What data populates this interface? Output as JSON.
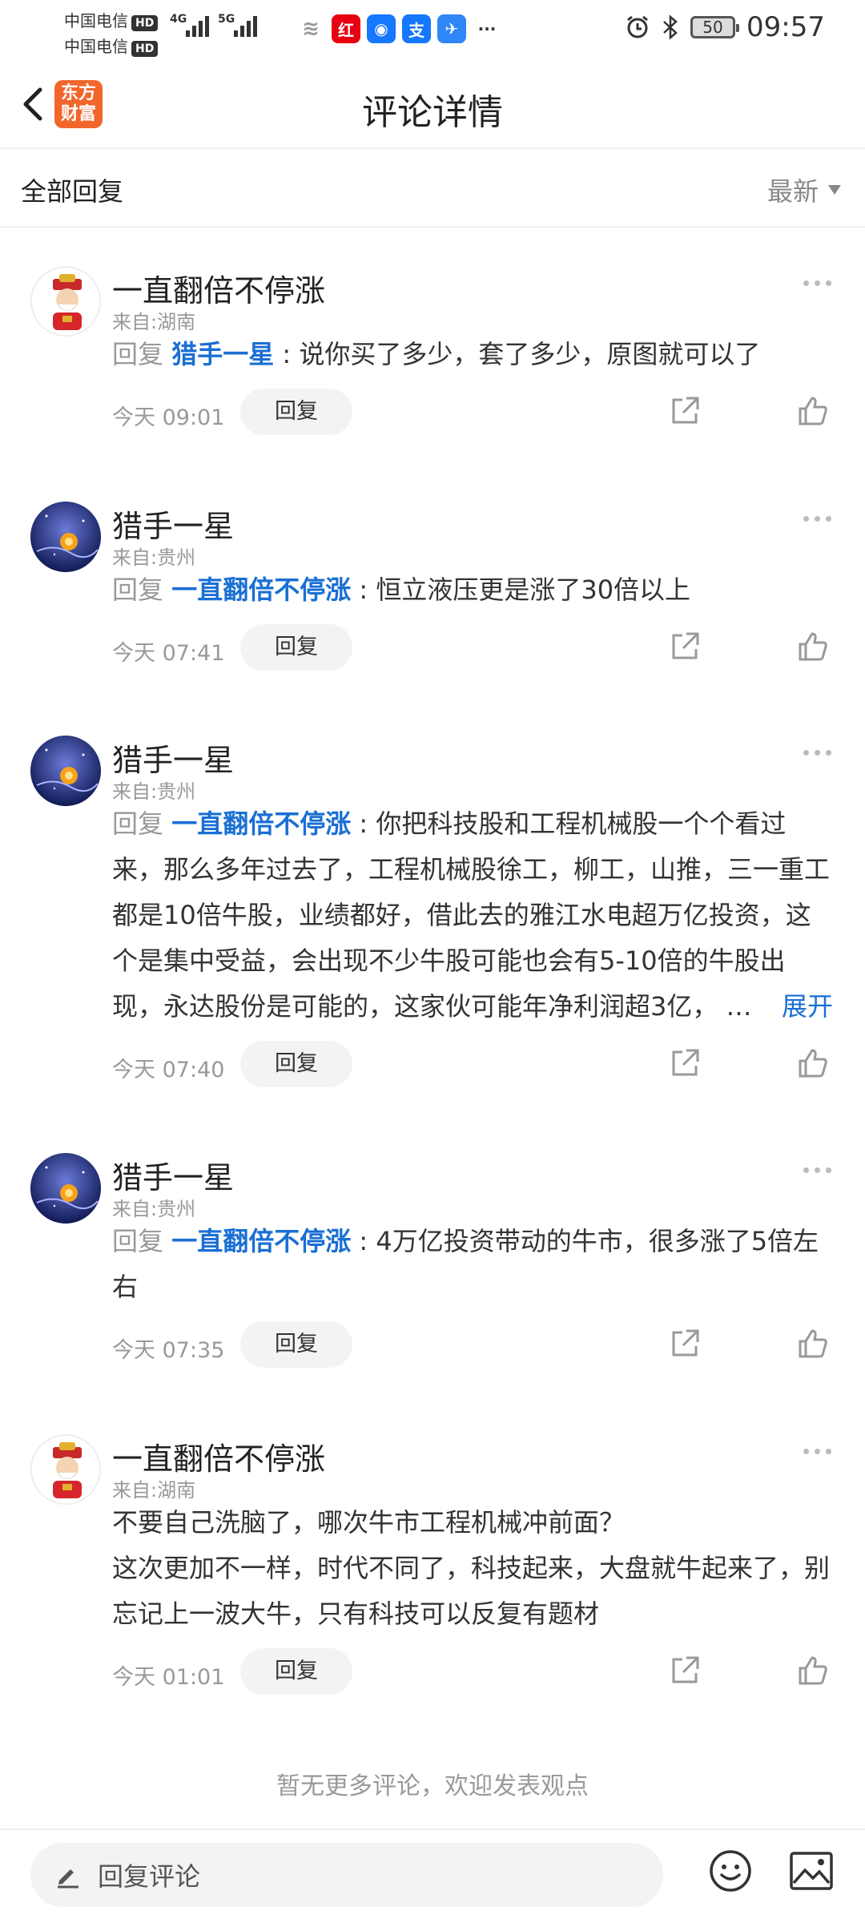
{
  "status_bar": {
    "carrier1": "中国电信",
    "carrier2": "中国电信",
    "hd_badge": "HD",
    "net1": "4G",
    "net2": "5G",
    "app_icons": [
      "weibo-icon",
      "ximalaya-icon",
      "qq-icon",
      "alipay-icon",
      "mail-icon"
    ],
    "more_dots": "···",
    "battery": "50",
    "time": "09:57"
  },
  "header": {
    "logo_line1": "东方",
    "logo_line2": "财富",
    "title": "评论详情"
  },
  "subheader": {
    "all_replies": "全部回复",
    "sort_label": "最新"
  },
  "comments": [
    {
      "user": "一直翻倍不停涨",
      "location": "来自:湖南",
      "reply_prefix": "回复",
      "mention": "猎手一星",
      "text": " : 说你买了多少，套了多少，原图就可以了",
      "time": "今天 09:01",
      "reply_label": "回复"
    },
    {
      "user": "猎手一星",
      "location": "来自:贵州",
      "reply_prefix": "回复",
      "mention": "一直翻倍不停涨",
      "text": " : 恒立液压更是涨了30倍以上",
      "time": "今天 07:41",
      "reply_label": "回复"
    },
    {
      "user": "猎手一星",
      "location": "来自:贵州",
      "reply_prefix": "回复",
      "mention": "一直翻倍不停涨",
      "text": " : 你把科技股和工程机械股一个个看过来，那么多年过去了，工程机械股徐工，柳工，山推，三一重工都是10倍牛股，业绩都好，借此去的雅江水电超万亿投资，这个是集中受益，会出现不少牛股可能也会有5-10倍的牛股出现，永达股份是可能的，这家伙可能年净利润超3亿，",
      "ellipsis": "…",
      "expand": "展开",
      "time": "今天 07:40",
      "reply_label": "回复"
    },
    {
      "user": "猎手一星",
      "location": "来自:贵州",
      "reply_prefix": "回复",
      "mention": "一直翻倍不停涨",
      "text": " : 4万亿投资带动的牛市，很多涨了5倍左右",
      "time": "今天 07:35",
      "reply_label": "回复"
    },
    {
      "user": "一直翻倍不停涨",
      "location": "来自:湖南",
      "text": "不要自己洗脑了，哪次牛市工程机械冲前面？\n这次更加不一样，时代不同了，科技起来，大盘就牛起来了，别忘记上一波大牛，只有科技可以反复有题材",
      "time": "今天 01:01",
      "reply_label": "回复"
    }
  ],
  "no_more": "暂无更多评论，欢迎发表观点",
  "bottom_bar": {
    "input_placeholder": "回复评论"
  }
}
